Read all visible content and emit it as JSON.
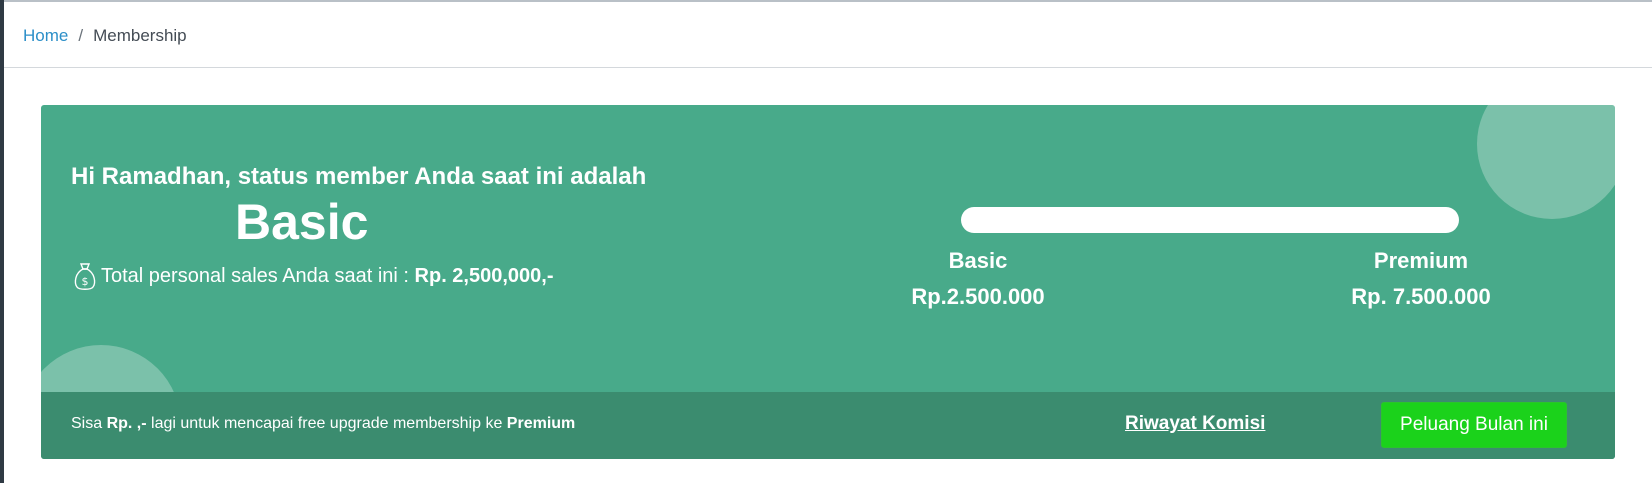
{
  "breadcrumb": {
    "home": "Home",
    "separator": "/",
    "current": "Membership"
  },
  "membership": {
    "greeting": "Hi Ramadhan, status member Anda saat ini adalah",
    "level": "Basic",
    "sales_label": "Total personal sales Anda saat ini :",
    "sales_amount": "Rp. 2,500,000,-",
    "sales_icon": "money-bag-icon",
    "progress_fraction": 1.0
  },
  "tiers": [
    {
      "name": "Basic",
      "price": "Rp.2.500.000"
    },
    {
      "name": "Premium",
      "price": "Rp. 7.500.000"
    }
  ],
  "footer": {
    "remaining_prefix": "Sisa",
    "remaining_amount": "Rp. ,-",
    "remaining_middle": "lagi untuk mencapai free upgrade membership ke",
    "remaining_target": "Premium",
    "history_link": "Riwayat Komisi",
    "opportunity_button": "Peluang Bulan ini"
  },
  "colors": {
    "card_bg": "#48aa8a",
    "footer_bg": "#3b8c6f",
    "link_blue": "#2c8fc8",
    "button_green": "#1bd21b"
  }
}
